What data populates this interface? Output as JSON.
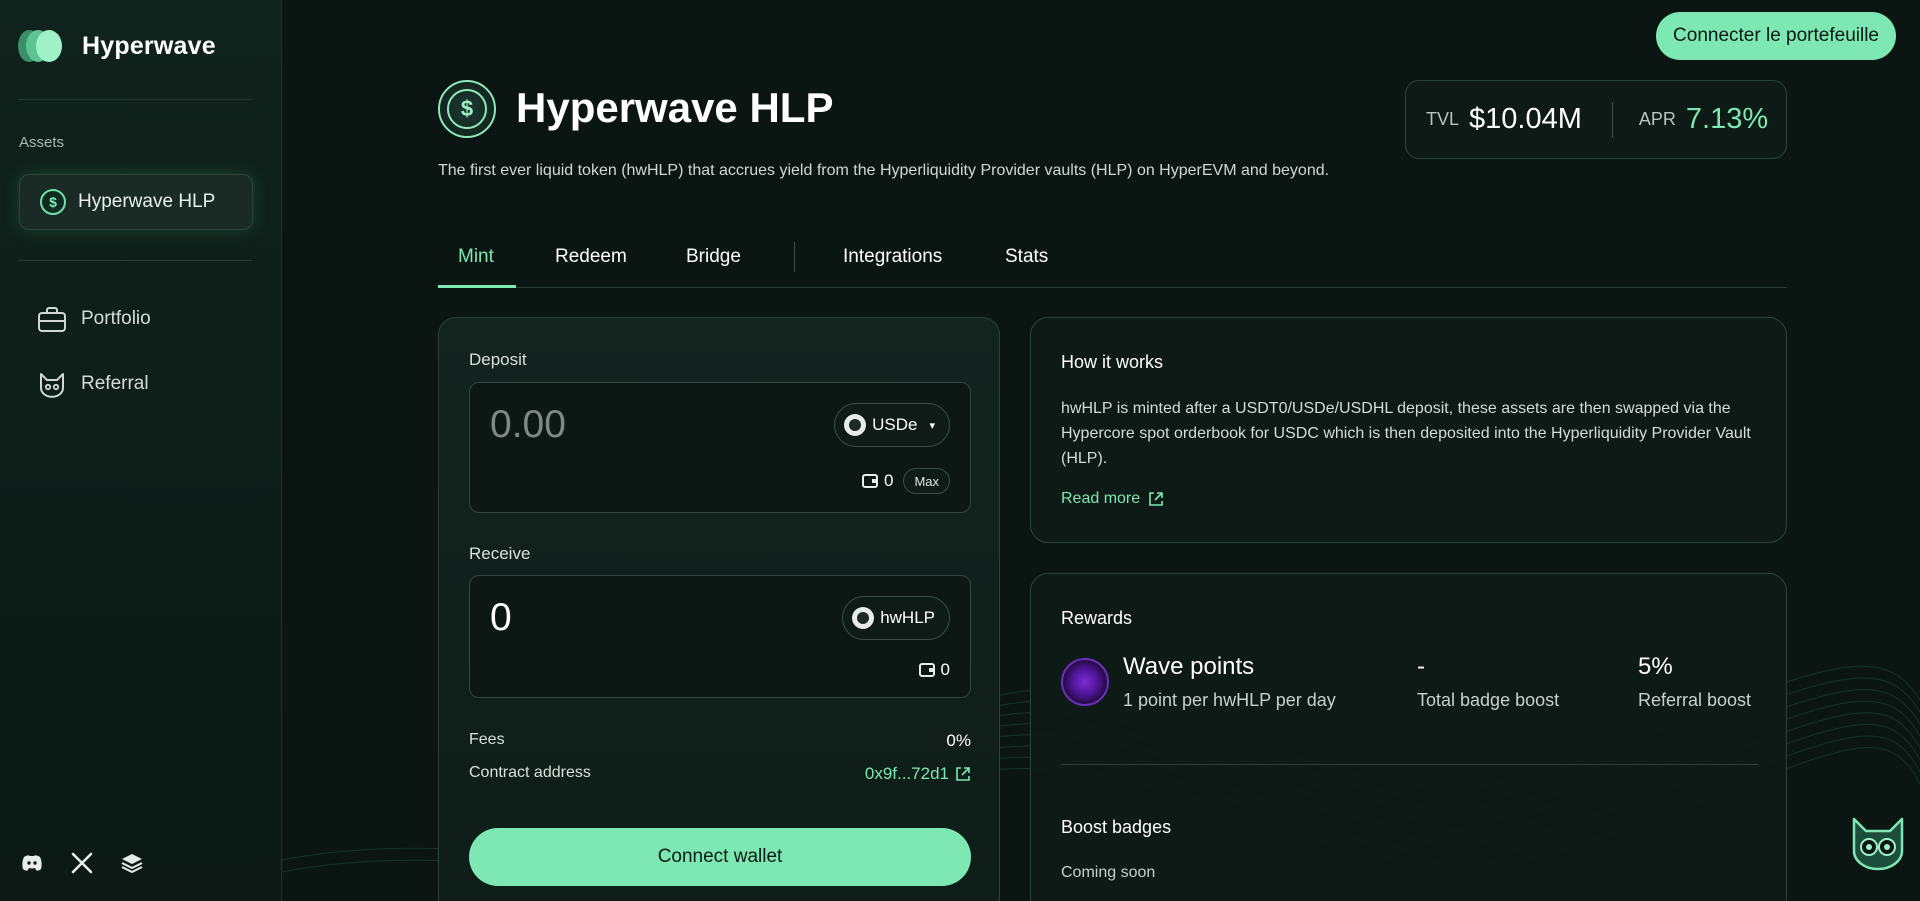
{
  "brand": {
    "name": "Hyperwave"
  },
  "sidebar": {
    "section_label": "Assets",
    "asset_item": {
      "label": "Hyperwave HLP"
    },
    "nav": [
      {
        "label": "Portfolio",
        "icon": "briefcase-icon"
      },
      {
        "label": "Referral",
        "icon": "cat-icon"
      }
    ],
    "social": [
      "discord-icon",
      "x-icon",
      "docs-stack-icon"
    ]
  },
  "header": {
    "connect_button": "Connecter le portefeuille",
    "title": "Hyperwave HLP",
    "description": "The first ever liquid token (hwHLP) that accrues yield from the Hyperliquidity Provider vaults (HLP) on HyperEVM and beyond.",
    "tvl_label": "TVL",
    "tvl_value": "$10.04M",
    "apr_label": "APR",
    "apr_value": "7.13%"
  },
  "tabs": [
    {
      "label": "Mint",
      "active": true
    },
    {
      "label": "Redeem"
    },
    {
      "label": "Bridge"
    },
    {
      "label": "Integrations"
    },
    {
      "label": "Stats"
    }
  ],
  "mint": {
    "deposit_label": "Deposit",
    "deposit_amount": "0.00",
    "deposit_token": "USDe",
    "deposit_balance": "0",
    "max_label": "Max",
    "receive_label": "Receive",
    "receive_amount": "0",
    "receive_token": "hwHLP",
    "receive_balance": "0",
    "fees_label": "Fees",
    "fees_value": "0%",
    "contract_label": "Contract address",
    "contract_value": "0x9f...72d1",
    "connect_button": "Connect wallet"
  },
  "how_it_works": {
    "title": "How it works",
    "text": "hwHLP is minted after a USDT0/USDe/USDHL deposit, these assets are then swapped via the Hypercore spot orderbook for USDC which is then deposited into the Hyperliquidity Provider Vault (HLP).",
    "read_more": "Read more"
  },
  "rewards": {
    "title": "Rewards",
    "wave_points_title": "Wave points",
    "wave_points_sub": "1 point per hwHLP per day",
    "badge_boost_value": "-",
    "badge_boost_label": "Total badge boost",
    "referral_boost_value": "5%",
    "referral_boost_label": "Referral boost",
    "boost_badges_title": "Boost badges",
    "boost_badges_status": "Coming soon"
  },
  "colors": {
    "accent": "#7ee8b4",
    "background": "#0b1613",
    "purple": "#7b2cd6"
  }
}
